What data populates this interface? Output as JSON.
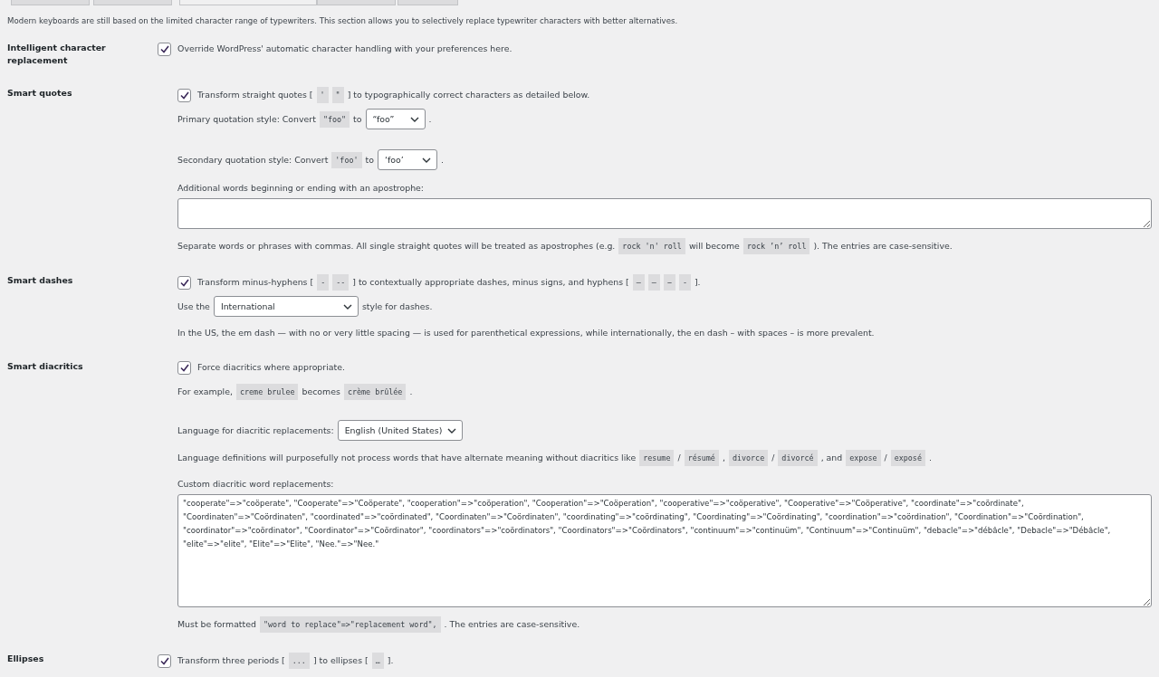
{
  "intro": "Modern keyboards are still based on the limited character range of typewriters. This section allows you to selectively replace typewriter characters with better alternatives.",
  "sections": [
    {
      "label": "Intelligent character replacement",
      "nested": false,
      "items": [
        {
          "kind": "checkbox",
          "checked": true,
          "parts": [
            {
              "kind": "text",
              "text": "Override WordPress' automatic character handling with your preferences here."
            }
          ]
        }
      ]
    },
    {
      "label": "Smart quotes",
      "nested": true,
      "items": [
        {
          "kind": "checkbox",
          "checked": true,
          "parts": [
            {
              "kind": "text",
              "text": "Transform straight quotes ["
            },
            {
              "kind": "code",
              "text": "'"
            },
            {
              "kind": "code",
              "text": "\""
            },
            {
              "kind": "text",
              "text": "] to typographically correct characters as detailed below."
            }
          ]
        },
        {
          "kind": "line",
          "parts": [
            {
              "kind": "text",
              "text": "Primary quotation style: Convert"
            },
            {
              "kind": "code",
              "text": "\"foo\""
            },
            {
              "kind": "text",
              "text": "to"
            },
            {
              "kind": "select",
              "value": "“foo”"
            },
            {
              "kind": "text",
              "text": "."
            }
          ]
        },
        {
          "kind": "gapline",
          "parts": [
            {
              "kind": "text",
              "text": "Secondary quotation style: Convert"
            },
            {
              "kind": "code",
              "text": "'foo'"
            },
            {
              "kind": "text",
              "text": "to"
            },
            {
              "kind": "select",
              "value": "‘foo’"
            },
            {
              "kind": "text",
              "text": "."
            }
          ]
        },
        {
          "kind": "textarea",
          "label": "Additional words beginning or ending with an apostrophe:",
          "value": ""
        },
        {
          "kind": "hint",
          "parts": [
            {
              "kind": "text",
              "text": "Separate words or phrases with commas. All single straight quotes will be treated as apostrophes (e.g."
            },
            {
              "kind": "code",
              "text": "rock 'n' roll"
            },
            {
              "kind": "text",
              "text": "will become"
            },
            {
              "kind": "code",
              "text": "rock ’n’ roll"
            },
            {
              "kind": "text",
              "text": "). The entries are case-sensitive."
            }
          ]
        }
      ]
    },
    {
      "label": "Smart dashes",
      "nested": true,
      "items": [
        {
          "kind": "checkbox",
          "checked": true,
          "parts": [
            {
              "kind": "text",
              "text": "Transform minus-hyphens ["
            },
            {
              "kind": "code",
              "text": "-"
            },
            {
              "kind": "code",
              "text": "--"
            },
            {
              "kind": "text",
              "text": "] to contextually appropriate dashes, minus signs, and hyphens ["
            },
            {
              "kind": "code",
              "text": "–"
            },
            {
              "kind": "code",
              "text": "—"
            },
            {
              "kind": "code",
              "text": "−"
            },
            {
              "kind": "code",
              "text": "‐"
            },
            {
              "kind": "text",
              "text": "]."
            }
          ]
        },
        {
          "kind": "line",
          "parts": [
            {
              "kind": "text",
              "text": "Use the"
            },
            {
              "kind": "wideselect",
              "value": "International"
            },
            {
              "kind": "text",
              "text": "style for dashes."
            }
          ]
        },
        {
          "kind": "hint",
          "parts": [
            {
              "kind": "text",
              "text": "In the US, the em dash — with no or very little spacing — is used for parenthetical expressions, while internationally, the en dash – with spaces – is more prevalent."
            }
          ]
        }
      ]
    },
    {
      "label": "Smart diacritics",
      "nested": true,
      "items": [
        {
          "kind": "checkbox",
          "checked": true,
          "parts": [
            {
              "kind": "text",
              "text": "Force diacritics where appropriate."
            }
          ]
        },
        {
          "kind": "hint",
          "parts": [
            {
              "kind": "text",
              "text": "For example,"
            },
            {
              "kind": "code",
              "text": "creme brulee"
            },
            {
              "kind": "text",
              "text": "becomes"
            },
            {
              "kind": "code",
              "text": "crème brûlée"
            },
            {
              "kind": "text",
              "text": "."
            }
          ]
        },
        {
          "kind": "gapline",
          "parts": [
            {
              "kind": "text",
              "text": "Language for diacritic replacements:"
            },
            {
              "kind": "select",
              "value": "English (United States)"
            }
          ]
        },
        {
          "kind": "hint",
          "parts": [
            {
              "kind": "text",
              "text": "Language definitions will purposefully not process words that have alternate meaning without diacritics like"
            },
            {
              "kind": "code",
              "text": "resume"
            },
            {
              "kind": "text",
              "text": "/"
            },
            {
              "kind": "code",
              "text": "résumé"
            },
            {
              "kind": "text",
              "text": ","
            },
            {
              "kind": "code",
              "text": "divorce"
            },
            {
              "kind": "text",
              "text": "/"
            },
            {
              "kind": "code",
              "text": "divorcé"
            },
            {
              "kind": "text",
              "text": ", and"
            },
            {
              "kind": "code",
              "text": "expose"
            },
            {
              "kind": "text",
              "text": "/"
            },
            {
              "kind": "code",
              "text": "exposé"
            },
            {
              "kind": "text",
              "text": "."
            }
          ]
        },
        {
          "kind": "bigtextarea",
          "label": "Custom diacritic word replacements:",
          "value": "\"cooperate\"=>\"coöperate\", \"Cooperate\"=>\"Coöperate\", \"cooperation\"=>\"coöperation\", \"Cooperation\"=>\"Coöperation\", \"cooperative\"=>\"coöperative\", \"Cooperative\"=>\"Coöperative\", \"coordinate\"=>\"coördinate\", \"Coordinaten\"=>\"Coördinaten\", \"coordinated\"=>\"coördinated\", \"Coordinaten\"=>\"Coördinaten\", \"coordinating\"=>\"coördinating\", \"Coordinating\"=>\"Coördinating\", \"coordination\"=>\"coördination\", \"Coordination\"=>\"Coördination\", \"coordinator\"=>\"coördinator\", \"Coordinator\"=>\"Coördinator\", \"coordinators\"=>\"coördinators\", \"Coordinators\"=>\"Coördinators\", \"continuum\"=>\"continuüm\", \"Continuum\"=>\"Continuüm\", \"debacle\"=>\"débâcle\", \"Debacle\"=>\"Débâcle\", \"elite\"=>\"elite\", \"Elite\"=>\"Elite\", \"Nee.\"=>\"Nee.\""
        },
        {
          "kind": "hint",
          "parts": [
            {
              "kind": "text",
              "text": "Must be formatted"
            },
            {
              "kind": "code",
              "text": "\"word to replace\"=>\"replacement word\","
            },
            {
              "kind": "text",
              "text": ". The entries are case-sensitive."
            }
          ]
        }
      ]
    },
    {
      "label": "Ellipses",
      "nested": false,
      "items": [
        {
          "kind": "checkbox",
          "checked": true,
          "parts": [
            {
              "kind": "text",
              "text": "Transform three periods ["
            },
            {
              "kind": "code",
              "text": "..."
            },
            {
              "kind": "text",
              "text": "] to ellipses ["
            },
            {
              "kind": "code",
              "text": "…"
            },
            {
              "kind": "text",
              "text": "]."
            }
          ]
        }
      ]
    }
  ]
}
